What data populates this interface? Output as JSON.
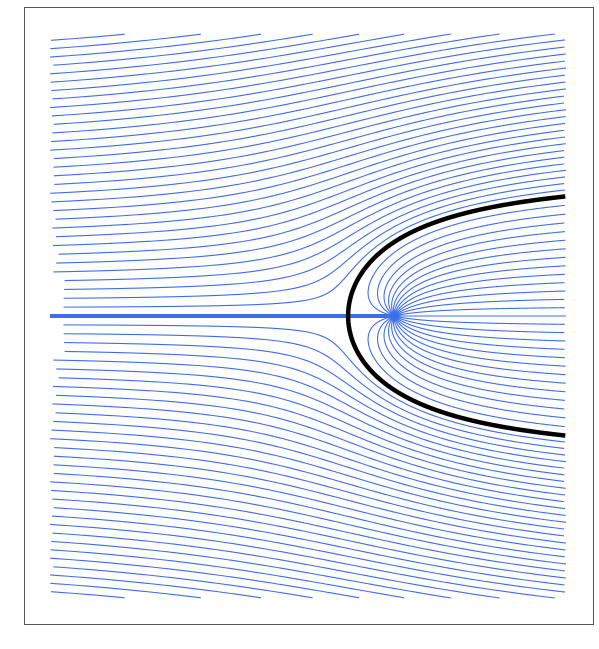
{
  "figure": {
    "description_type": "streamlines of flow past a Rankine half-body",
    "colors": {
      "streamline": "#3d6ee8",
      "stagnation_line": "#3d6ee8",
      "body_boundary": "#000000",
      "frame": "#555555",
      "background": "#ffffff"
    },
    "flow": {
      "uniform_velocity": 1,
      "source_strength_m_over_2pi": 0.4,
      "stagnation_point": [
        -0.4,
        0
      ],
      "x_range": [
        -3,
        1.5
      ],
      "y_range": [
        -2.4,
        2.4
      ],
      "streamline_psi_values_step": 0.065,
      "streamline_count_each_side": 37
    }
  }
}
